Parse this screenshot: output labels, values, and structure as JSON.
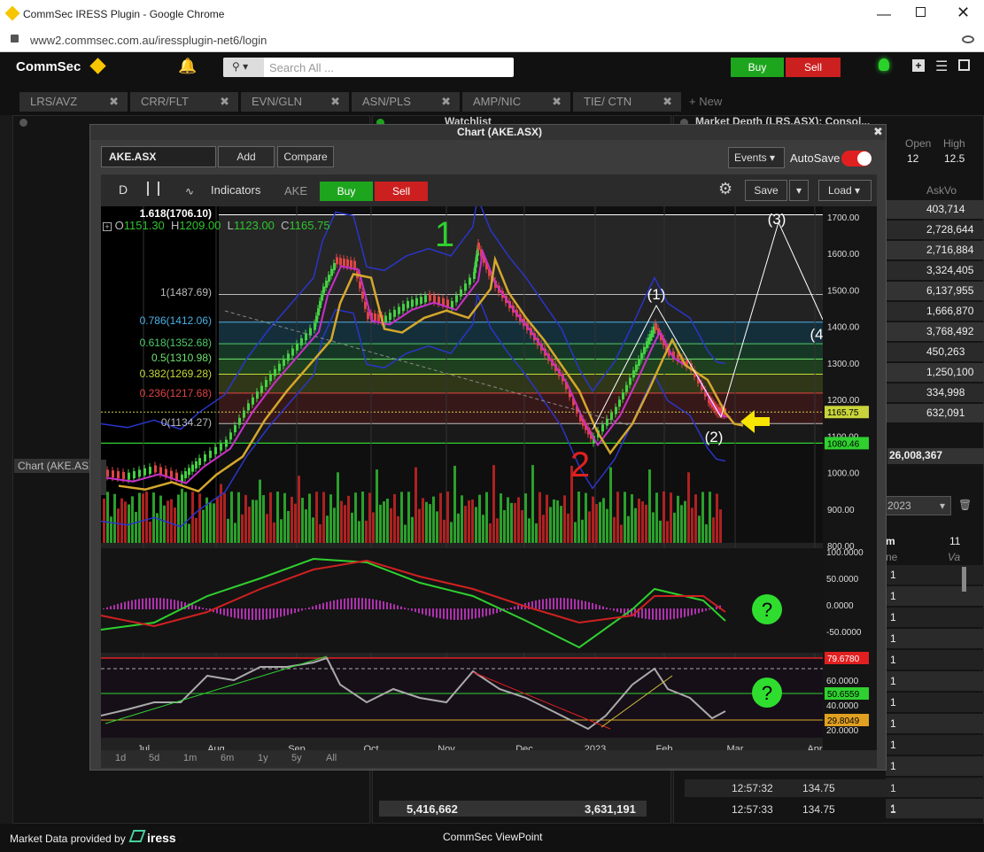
{
  "browser": {
    "title": "CommSec IRESS Plugin - Google Chrome",
    "url": "www2.commsec.com.au/iressplugin-net6/login"
  },
  "app": {
    "logo": "CommSec",
    "search_placeholder": "Search All ...",
    "buy": "Buy",
    "sell": "Sell"
  },
  "tabs": [
    {
      "label": "LRS/AVZ"
    },
    {
      "label": "CRR/FLT"
    },
    {
      "label": "EVN/GLN"
    },
    {
      "label": "ASN/PLS"
    },
    {
      "label": "AMP/NIC"
    },
    {
      "label": "TIE/ CTN"
    }
  ],
  "new_tab": "New",
  "watchlist_title": "Watchlist",
  "market_depth_title": "Market Depth (LRS.ASX): Consol...",
  "depth": {
    "open_label": "Open",
    "high_label": "High",
    "open": "12",
    "high": "12.5",
    "ask_vol_label": "AskVo",
    "ask_vols": [
      "403,714",
      "2,728,644",
      "2,716,884",
      "3,324,405",
      "6,137,955",
      "1,666,870",
      "3,768,492",
      "450,263",
      "1,250,100",
      "334,998",
      "632,091"
    ],
    "total": "26,008,367",
    "date": "2023",
    "col_m": "m",
    "col_11": "11",
    "col_ne": "ne",
    "col_va": "Va",
    "rows": [
      "1",
      "1",
      "1",
      "1",
      "1",
      "1",
      "1",
      "1",
      "1",
      "1",
      "1",
      "1"
    ],
    "trades": [
      {
        "time": "12:57:32",
        "price": "134.75",
        "qty": "1"
      },
      {
        "time": "12:57:33",
        "price": "134.75",
        "qty": "1"
      }
    ]
  },
  "bottom_totals": {
    "left": "5,416,662",
    "right": "3,631,191"
  },
  "sidebar_chart_label": "Chart (AKE.ASX",
  "footer": {
    "provided": "Market Data provided by",
    "brand": "iress",
    "center": "CommSec ViewPoint"
  },
  "chart_window": {
    "title": "Chart (AKE.ASX)",
    "symbol": "AKE.ASX",
    "add": "Add",
    "compare": "Compare",
    "events": "Events",
    "autosave": "AutoSave",
    "interval": "D",
    "indicators": "Indicators",
    "ticker": "AKE",
    "buy": "Buy",
    "sell": "Sell",
    "save": "Save",
    "load": "Load",
    "ohlc": {
      "o_label": "O",
      "o": "1151.30",
      "h_label": "H",
      "h": "1209.00",
      "l_label": "L",
      "l": "1123.00",
      "c_label": "C",
      "c": "1165.75"
    },
    "fib": [
      {
        "label": "1.618(1706.10)",
        "color": "#ffffff"
      },
      {
        "label": "1(1487.69)",
        "color": "#bbbbbb"
      },
      {
        "label": "0.786(1412.06)",
        "color": "#4ab0e6"
      },
      {
        "label": "0.618(1352.68)",
        "color": "#4ccc6a"
      },
      {
        "label": "0.5(1310.98)",
        "color": "#6fe36f"
      },
      {
        "label": "0.382(1269.28)",
        "color": "#c7d93a"
      },
      {
        "label": "0.236(1217.68)",
        "color": "#e04444"
      },
      {
        "label": "0(1134.27)",
        "color": "#bbbbbb"
      }
    ],
    "price_axis": [
      "1700.00",
      "1600.00",
      "1500.00",
      "1400.00",
      "1300.00",
      "1200.00",
      "1100.00",
      "1000.00",
      "900.00",
      "800.00"
    ],
    "last_price": "1165.75",
    "support_price": "1080.46",
    "macd_axis": [
      "100.0000",
      "50.0000",
      "0.0000",
      "-50.0000"
    ],
    "rsi_axis": [
      "60.0000",
      "40.0000",
      "20.0000"
    ],
    "rsi_tags": {
      "top": "79.6780",
      "mid": "50.6559",
      "low": "29.8049"
    },
    "months": [
      "Jul",
      "Aug",
      "Sep",
      "Oct",
      "Nov",
      "Dec",
      "2023",
      "Feb",
      "Mar",
      "Apr"
    ],
    "ranges": [
      "1d",
      "5d",
      "1m",
      "6m",
      "1y",
      "5y",
      "All"
    ],
    "annotations": {
      "wave1": "1",
      "wave2": "2",
      "w1": "(1)",
      "w2": "(2)",
      "w3": "(3)",
      "w4": "(4",
      "q": "?"
    }
  },
  "colors": {
    "green": "#1ea51e",
    "red": "#cc1f1f",
    "accent": "#f7c600"
  }
}
